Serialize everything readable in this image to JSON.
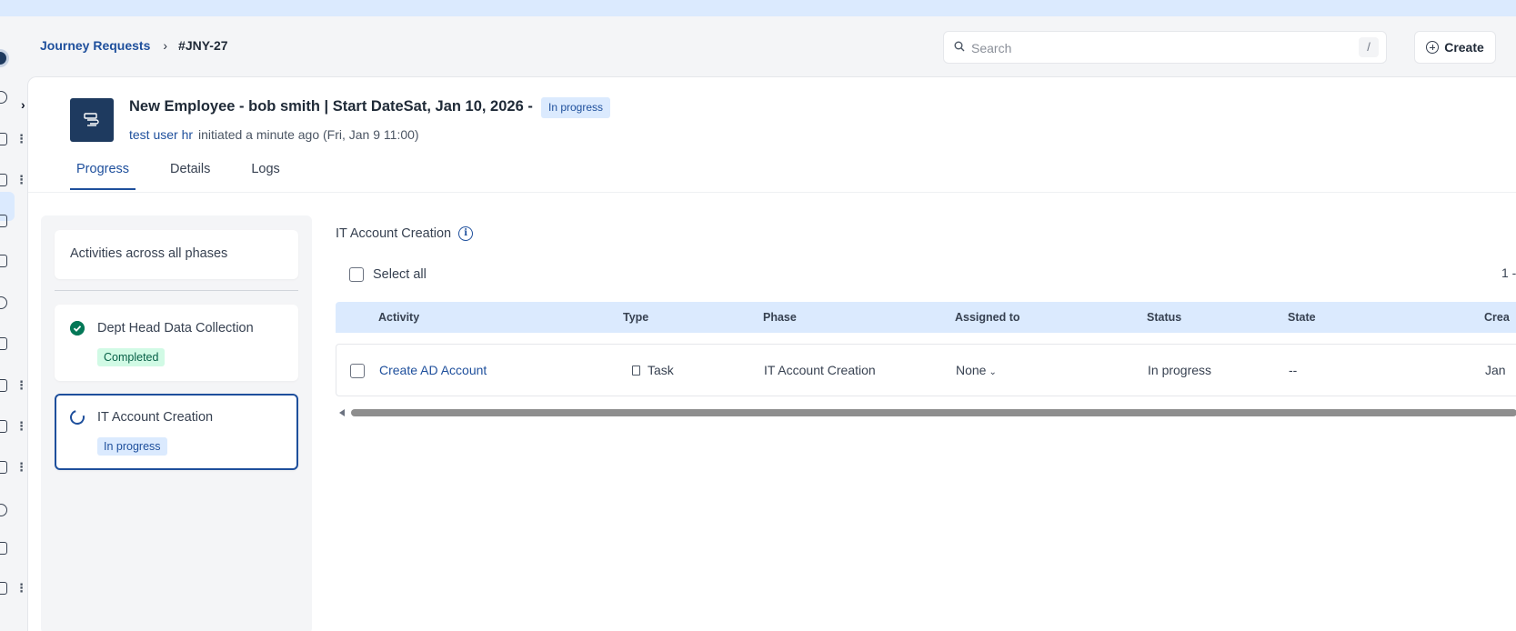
{
  "breadcrumb": {
    "parent": "Journey Requests",
    "current": "#JNY-27"
  },
  "search": {
    "placeholder": "Search",
    "shortcut": "/"
  },
  "toolbar": {
    "create_label": "Create"
  },
  "request": {
    "title": "New Employee - bob smith | Start DateSat, Jan 10, 2026 -",
    "status": "In progress",
    "initiator": "test user hr",
    "initiated_text": "initiated a minute ago (Fri, Jan 9 11:00)"
  },
  "tabs": [
    {
      "label": "Progress",
      "active": true
    },
    {
      "label": "Details",
      "active": false
    },
    {
      "label": "Logs",
      "active": false
    }
  ],
  "phases": {
    "all_label": "Activities across all phases",
    "items": [
      {
        "label": "Dept Head Data Collection",
        "badge": "Completed",
        "state": "completed"
      },
      {
        "label": "IT Account Creation",
        "badge": "In progress",
        "state": "in-progress"
      }
    ]
  },
  "activities": {
    "section_title": "IT Account Creation",
    "select_all_label": "Select all",
    "pager_text": "1 -",
    "columns": [
      "Activity",
      "Type",
      "Phase",
      "Assigned to",
      "Status",
      "State",
      "Crea"
    ],
    "rows": [
      {
        "activity": "Create AD Account",
        "type": "Task",
        "phase": "IT Account Creation",
        "assigned_to": "None",
        "status": "In progress",
        "state": "--",
        "created": "Jan"
      }
    ]
  },
  "icons": {
    "header": "journey-icon",
    "search": "search-icon",
    "create": "plus-circle-icon",
    "info": "info-icon",
    "check": "check-circle-icon",
    "spinner": "spinner-icon",
    "task": "task-icon"
  },
  "colors": {
    "accent": "#1e4f9c",
    "banner": "#dbeafe",
    "header_icon_bg": "#1e3a5f",
    "completed_green": "#047857"
  }
}
